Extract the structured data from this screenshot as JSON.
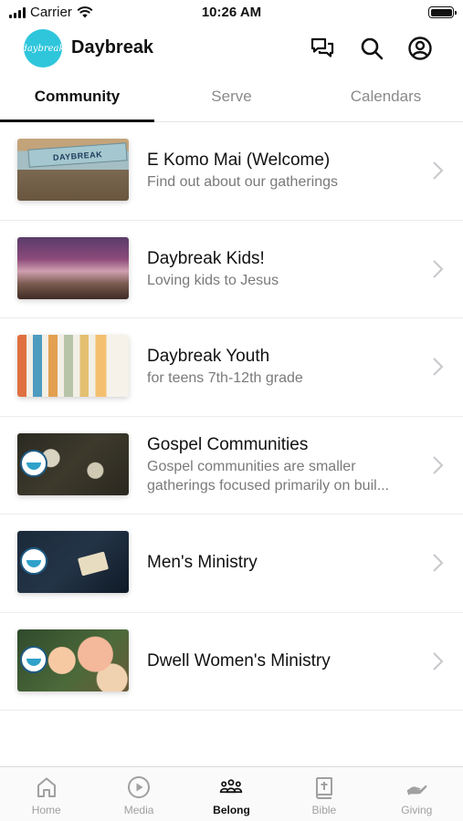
{
  "status_bar": {
    "carrier": "Carrier",
    "time": "10:26 AM"
  },
  "header": {
    "logo_text": "daybreak",
    "title": "Daybreak",
    "icons": [
      "chat-icon",
      "search-icon",
      "account-icon"
    ]
  },
  "tabs": [
    {
      "label": "Community",
      "active": true
    },
    {
      "label": "Serve",
      "active": false
    },
    {
      "label": "Calendars",
      "active": false
    }
  ],
  "items": [
    {
      "title": "E Komo Mai (Welcome)",
      "subtitle": "Find out about our gatherings",
      "thumb_text": "DAYBREAK"
    },
    {
      "title": "Daybreak Kids!",
      "subtitle": "Loving kids to Jesus"
    },
    {
      "title": "Daybreak Youth",
      "subtitle": "for teens 7th-12th grade"
    },
    {
      "title": "Gospel Communities",
      "subtitle_line1": "Gospel communities are smaller",
      "subtitle_line2": "gatherings focused primarily on buil..."
    },
    {
      "title": "Men's Ministry"
    },
    {
      "title": "Dwell Women's Ministry"
    }
  ],
  "bottom_nav": [
    {
      "label": "Home",
      "icon": "home-icon",
      "active": false
    },
    {
      "label": "Media",
      "icon": "play-icon",
      "active": false
    },
    {
      "label": "Belong",
      "icon": "people-icon",
      "active": true
    },
    {
      "label": "Bible",
      "icon": "bible-icon",
      "active": false
    },
    {
      "label": "Giving",
      "icon": "hand-icon",
      "active": false
    }
  ],
  "colors": {
    "logo": "#2fc6dc",
    "active_tab_underline": "#111111",
    "inactive": "#8a8a8a"
  }
}
